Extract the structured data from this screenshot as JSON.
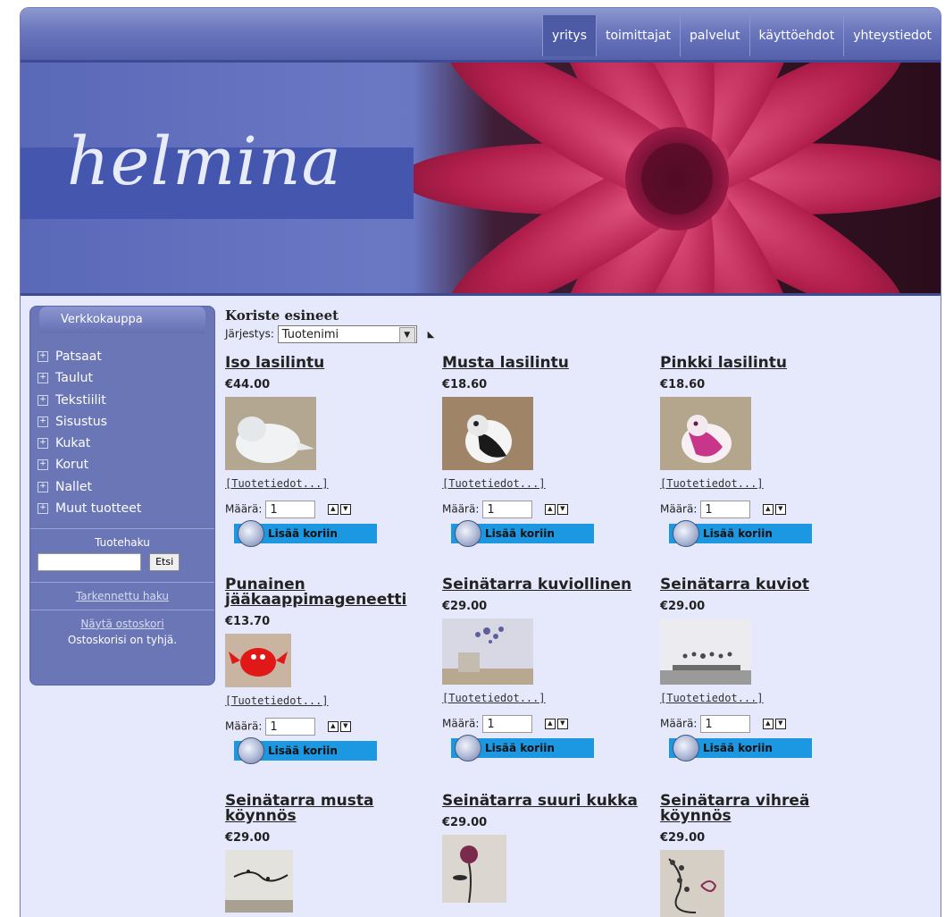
{
  "nav": {
    "items": [
      "yritys",
      "toimittajat",
      "palvelut",
      "käyttöehdot",
      "yhteystiedot"
    ],
    "active": "yritys"
  },
  "banner": {
    "logo": "helmina"
  },
  "sidebar": {
    "title": "Verkkokauppa",
    "categories": [
      "Patsaat",
      "Taulut",
      "Tekstiilit",
      "Sisustus",
      "Kukat",
      "Korut",
      "Nallet",
      "Muut tuotteet"
    ],
    "search_title": "Tuotehaku",
    "search_button": "Etsi",
    "advanced_search": "Tarkennettu haku",
    "show_cart": "Näytä ostoskori",
    "cart_status": "Ostoskorisi on tyhjä."
  },
  "main": {
    "category_title": "Koriste esineet",
    "sort_label": "Järjestys:",
    "sort_value": "Tuotenimi",
    "details_label": "[Tuotetiedot...]",
    "qty_label": "Määrä:",
    "qty_value": "1",
    "add_to_cart": "Lisää koriin"
  },
  "products": [
    {
      "name": "Iso lasilintu",
      "price": "€44.00",
      "image": "white-glass-bird"
    },
    {
      "name": "Musta lasilintu",
      "price": "€18.60",
      "image": "black-glass-bird"
    },
    {
      "name": "Pinkki lasilintu",
      "price": "€18.60",
      "image": "pink-glass-bird"
    },
    {
      "name": "Punainen jääkaappimageneetti",
      "price": "€13.70",
      "image": "red-magnet"
    },
    {
      "name": "Seinätarra kuviollinen",
      "price": "€29.00",
      "image": "wall-decal-room"
    },
    {
      "name": "Seinätarra kuviot",
      "price": "€29.00",
      "image": "wall-decal-pattern"
    },
    {
      "name": "Seinätarra musta köynnös",
      "price": "€29.00",
      "image": "wall-decal-black-vine"
    },
    {
      "name": "Seinätarra suuri kukka",
      "price": "€29.00",
      "image": "wall-decal-flower"
    },
    {
      "name": "Seinätarra vihreä köynnös",
      "price": "€29.00",
      "image": "wall-decal-green-vine"
    }
  ]
}
